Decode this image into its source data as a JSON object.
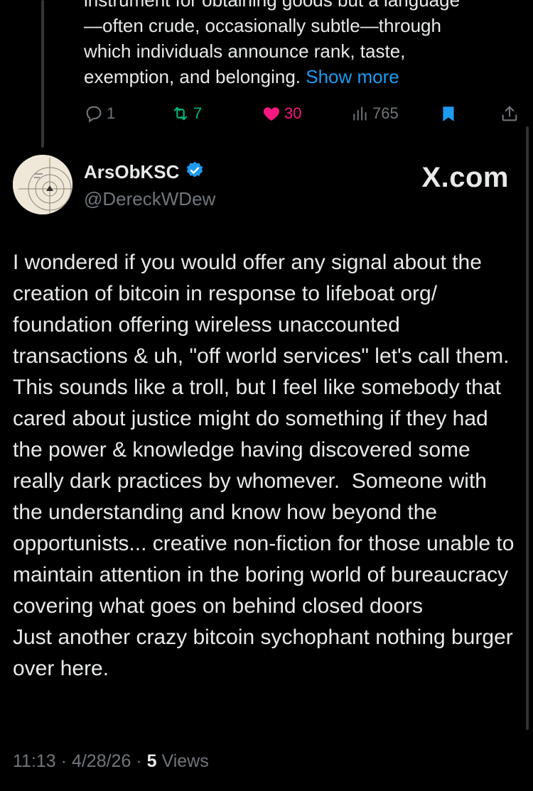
{
  "parent_tweet": {
    "text": "instrument for obtaining goods but a language\n—often crude, occasionally subtle—through\nwhich individuals announce rank, taste,\nexemption, and belonging.",
    "show_more": "Show more",
    "replies": "1",
    "reposts": "7",
    "likes": "30",
    "views": "765"
  },
  "tweet": {
    "author_name": "ArsObKSC",
    "author_handle": "@DereckWDew",
    "brand": "X.com",
    "text": "I wondered if you would offer any signal about the creation of bitcoin in response to lifeboat org/ foundation offering wireless unaccounted transactions & uh, \"off world services\" let's call them. This sounds like a troll, but I feel like somebody that cared about justice might do something if they had the power & knowledge having discovered some really dark practices by whomever.  Someone with the understanding and know how beyond the opportunists... creative non-fiction for those unable to maintain attention in the boring world of bureaucracy covering what goes on behind closed doors\nJust another crazy bitcoin sychophant nothing burger over here.",
    "time": "11:13",
    "date": "4/28/26",
    "views_count": "5",
    "views_label": "Views"
  },
  "colors": {
    "background": "#000000",
    "text": "#e7e9ea",
    "muted": "#71767b",
    "link": "#1d9bf0",
    "repost": "#00ba7c",
    "like": "#f91880",
    "verified": "#1d9bf0"
  },
  "icons": [
    "reply-icon",
    "repost-icon",
    "like-icon",
    "views-icon",
    "bookmark-icon",
    "share-icon",
    "verified-icon"
  ]
}
